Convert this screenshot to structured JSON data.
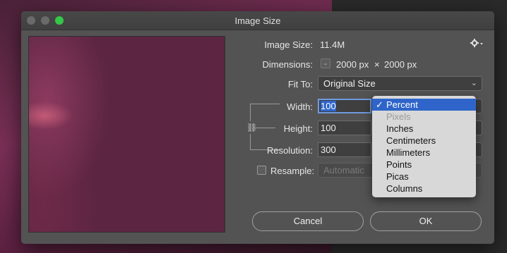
{
  "dialog": {
    "title": "Image Size"
  },
  "info": {
    "image_size_label": "Image Size:",
    "image_size_value": "11.4M",
    "dimensions_label": "Dimensions:",
    "dim_width": "2000 px",
    "dim_times": "×",
    "dim_height": "2000 px"
  },
  "fit_to": {
    "label": "Fit To:",
    "value": "Original Size"
  },
  "width": {
    "label": "Width:",
    "value": "100"
  },
  "height": {
    "label": "Height:",
    "value": "100"
  },
  "resolution": {
    "label": "Resolution:",
    "value": "300"
  },
  "resample": {
    "label": "Resample:",
    "checked": false,
    "value": "Automatic"
  },
  "units_menu": {
    "items": [
      {
        "label": "Percent",
        "selected": true,
        "enabled": true
      },
      {
        "label": "Pixels",
        "selected": false,
        "enabled": false
      },
      {
        "label": "Inches",
        "selected": false,
        "enabled": true
      },
      {
        "label": "Centimeters",
        "selected": false,
        "enabled": true
      },
      {
        "label": "Millimeters",
        "selected": false,
        "enabled": true
      },
      {
        "label": "Points",
        "selected": false,
        "enabled": true
      },
      {
        "label": "Picas",
        "selected": false,
        "enabled": true
      },
      {
        "label": "Columns",
        "selected": false,
        "enabled": true
      }
    ]
  },
  "buttons": {
    "cancel": "Cancel",
    "ok": "OK"
  },
  "colors": {
    "accent": "#2f65ca",
    "zoom_button": "#34c749",
    "dialog_bg": "#535353"
  },
  "icons": {
    "settings": "gear-icon",
    "chevron": "chevron-down-icon",
    "check": "checkmark-icon"
  }
}
